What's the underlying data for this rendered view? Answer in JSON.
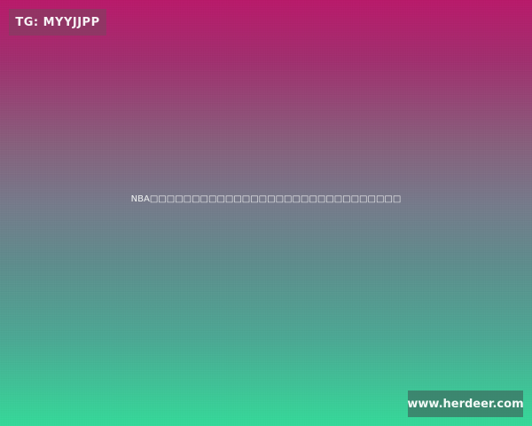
{
  "tg_badge": {
    "label": "TG: MYYJJPP"
  },
  "center": {
    "text": "NBA□□□□□□□□□□□□□□□□□□□□□□□□□□□□□□"
  },
  "site_badge": {
    "label": "www.herdeer.com"
  },
  "colors": {
    "top": "#b81a6a",
    "middle": "#757a8a",
    "bottom": "#35d898"
  }
}
